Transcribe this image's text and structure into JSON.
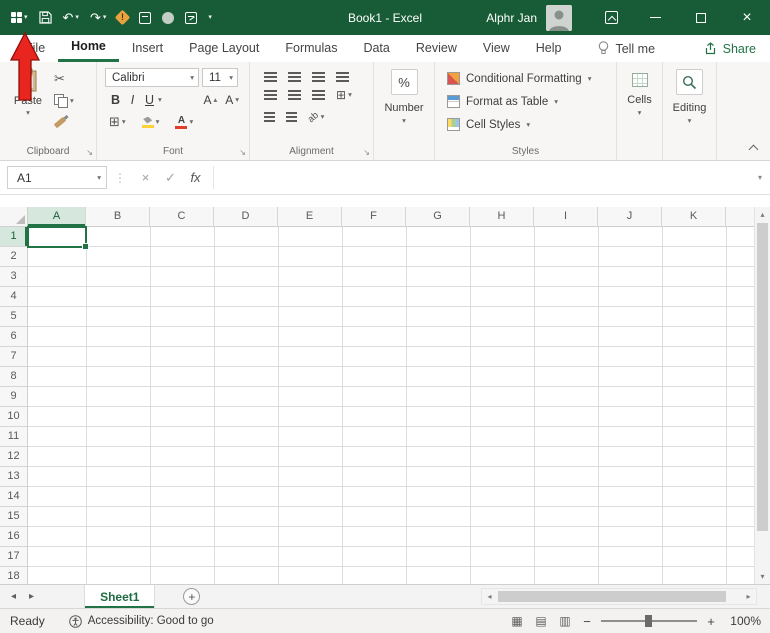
{
  "window": {
    "title": "Book1 - Excel",
    "user_name": "Alphr Jan"
  },
  "ribbon_tabs": {
    "file": "File",
    "items": [
      "Home",
      "Insert",
      "Page Layout",
      "Formulas",
      "Data",
      "Review",
      "View",
      "Help"
    ],
    "active": "Home",
    "tell_me": "Tell me",
    "share": "Share"
  },
  "ribbon": {
    "clipboard": {
      "label": "Clipboard",
      "paste": "Paste"
    },
    "font": {
      "label": "Font",
      "font_name": "Calibri",
      "font_size": "11",
      "bold": "B",
      "italic": "I",
      "underline": "U"
    },
    "alignment": {
      "label": "Alignment"
    },
    "number": {
      "percent": "%",
      "value": "Number"
    },
    "styles": {
      "label": "Styles",
      "items": [
        "Conditional Formatting",
        "Format as Table",
        "Cell Styles"
      ]
    },
    "cells": {
      "button": "Cells"
    },
    "editing": {
      "button": "Editing"
    }
  },
  "formula_bar": {
    "name_box": "A1",
    "fx": "fx",
    "formula": ""
  },
  "grid": {
    "columns": [
      "A",
      "B",
      "C",
      "D",
      "E",
      "F",
      "G",
      "H",
      "I",
      "J",
      "K"
    ],
    "rows": [
      "1",
      "2",
      "3",
      "4",
      "5",
      "6",
      "7",
      "8",
      "9",
      "10",
      "11",
      "12",
      "13",
      "14",
      "15",
      "16",
      "17",
      "18"
    ],
    "selected_cell": "A1"
  },
  "sheet_bar": {
    "active_tab": "Sheet1",
    "add_label": "+"
  },
  "status_bar": {
    "mode": "Ready",
    "accessibility": "Accessibility: Good to go",
    "zoom_level": "100%"
  },
  "icons": {
    "dropdown": "▾",
    "undo": "↶",
    "redo": "↷",
    "cut": "✂",
    "borders": "⊞",
    "merge": "⊞",
    "dots": "⋮",
    "cancel": "×",
    "check": "✓",
    "launcher": "↘",
    "up": "▴",
    "down": "▾",
    "left": "◂",
    "right": "▸",
    "view_normal": "▦",
    "view_layout": "▤",
    "view_break": "▥",
    "zoom_out": "−",
    "zoom_in": "+"
  },
  "colors": {
    "excel_green": "#217346",
    "title_bar": "#185c37",
    "selection": "#217346",
    "arrow_red": "#e8261f"
  }
}
